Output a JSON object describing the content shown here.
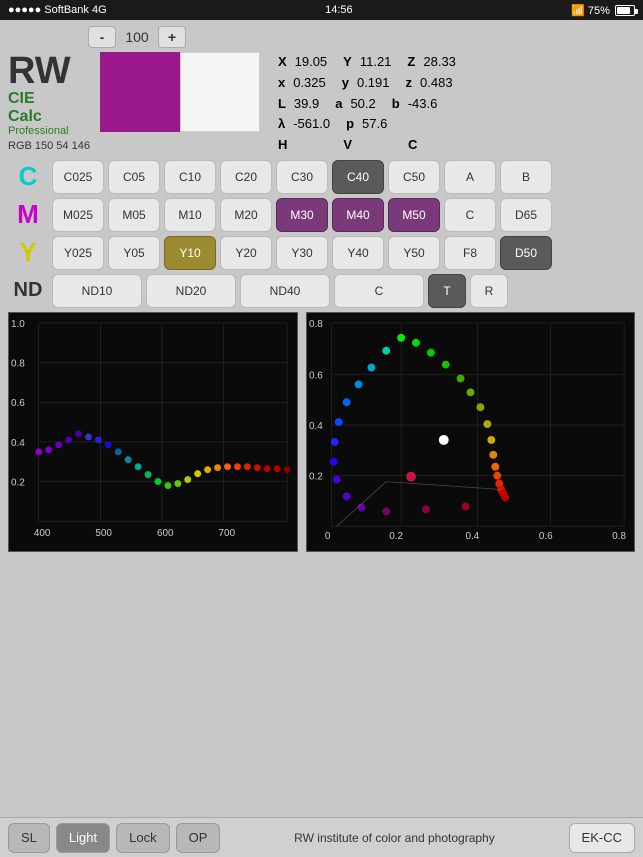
{
  "statusBar": {
    "carrier": "●●●●● SoftBank  4G",
    "time": "14:56",
    "bluetooth": "⚡",
    "batteryPct": "75%"
  },
  "stepper": {
    "minus": "-",
    "value": "100",
    "plus": "+"
  },
  "logo": {
    "rw": "RW",
    "cie": "CIE",
    "calc": "Calc",
    "professional": "Professional"
  },
  "rgb": {
    "label": "RGB  150  54  146"
  },
  "metrics": [
    {
      "label": "X",
      "value": "19.05",
      "label2": "Y",
      "value2": "11.21",
      "label3": "Z",
      "value3": "28.33"
    },
    {
      "label": "x",
      "value": "0.325",
      "label2": "y",
      "value2": "0.191",
      "label3": "z",
      "value3": "0.483"
    },
    {
      "label": "L",
      "value": "39.9",
      "label2": "a",
      "value2": "50.2",
      "label3": "b",
      "value3": "-43.6"
    },
    {
      "label": "λ",
      "value": "-561.0",
      "label2": "p",
      "value2": "57.6",
      "label3": "",
      "value3": ""
    },
    {
      "label": "H",
      "value": "",
      "label2": "V",
      "value2": "",
      "label3": "C",
      "value3": ""
    }
  ],
  "filterRows": {
    "C": {
      "label": "C",
      "buttons": [
        "C025",
        "C05",
        "C10",
        "C20",
        "C30",
        "C40",
        "C50",
        "A",
        "B"
      ],
      "active": [
        "C40"
      ]
    },
    "M": {
      "label": "M",
      "buttons": [
        "M025",
        "M05",
        "M10",
        "M20",
        "M30",
        "M40",
        "M50",
        "C",
        "D65"
      ],
      "active": [
        "M30",
        "M40",
        "M50"
      ]
    },
    "Y": {
      "label": "Y",
      "buttons": [
        "Y025",
        "Y05",
        "Y10",
        "Y20",
        "Y30",
        "Y40",
        "Y50",
        "F8",
        "D50"
      ],
      "active": [
        "Y10",
        "D50"
      ]
    },
    "ND": {
      "label": "ND",
      "buttons": [
        "ND10",
        "ND20",
        "ND40",
        "C",
        "T",
        "R"
      ],
      "active": [
        "T"
      ],
      "wide": [
        "ND10",
        "ND20",
        "ND40",
        "C"
      ]
    }
  },
  "graphs": {
    "left": {
      "xLabels": [
        "400",
        "500",
        "600",
        "700"
      ],
      "yLabels": [
        "1.0",
        "0.8",
        "0.6",
        "0.4",
        "0.2"
      ],
      "title": "left-graph"
    },
    "right": {
      "xLabels": [
        "0",
        "0.2",
        "0.4",
        "0.6",
        "0.8"
      ],
      "yLabels": [
        "0.8",
        "0.6",
        "0.4",
        "0.2"
      ],
      "title": "right-graph"
    }
  },
  "toolbar": {
    "sl": "SL",
    "light": "Light",
    "lock": "Lock",
    "op": "OP",
    "info": "RW institute of color and photography",
    "ekcc": "EK-CC"
  }
}
